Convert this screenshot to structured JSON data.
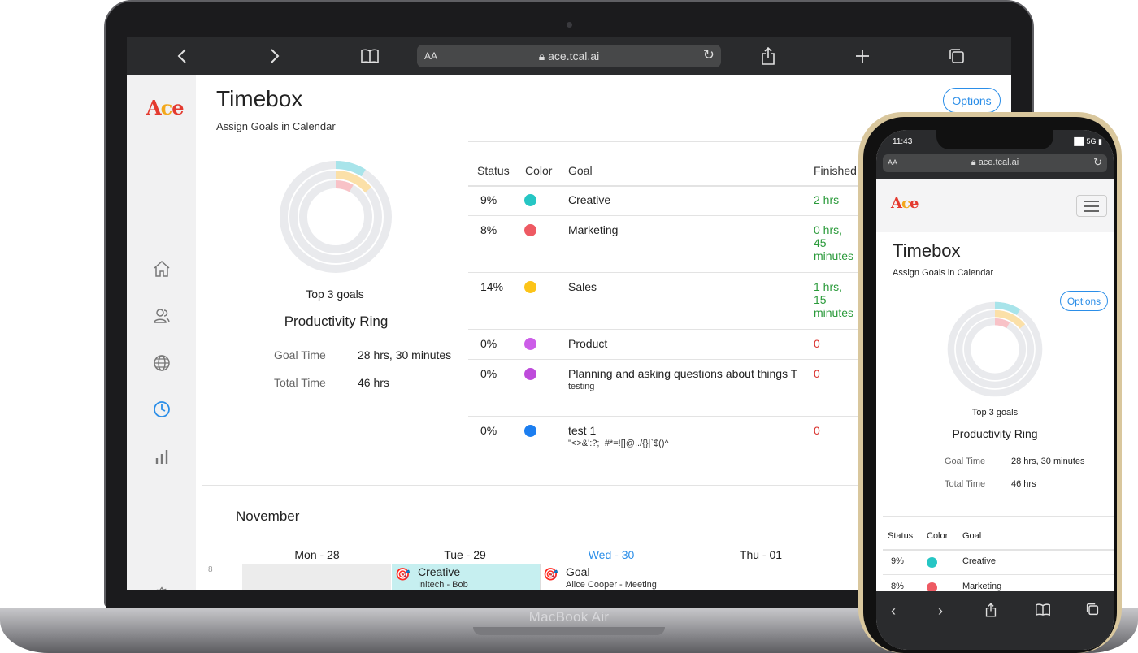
{
  "device_laptop": {
    "brand": "MacBook Air"
  },
  "browser": {
    "url": "ace.tcal.ai",
    "text_size_label": "AA"
  },
  "logo": {
    "letters": [
      "A",
      "c",
      "e"
    ]
  },
  "page": {
    "title": "Timebox",
    "subtitle": "Assign Goals in Calendar",
    "options_label": "Options"
  },
  "ring": {
    "caption": "Top 3 goals",
    "title": "Productivity Ring",
    "goal_time_label": "Goal Time",
    "goal_time_value": "28 hrs, 30 minutes",
    "total_time_label": "Total Time",
    "total_time_value": "46 hrs",
    "segments": [
      {
        "color": "#a8e4ea",
        "fraction": 0.09
      },
      {
        "color": "#fbe0a8",
        "fraction": 0.14
      },
      {
        "color": "#f8c2c7",
        "fraction": 0.08
      }
    ]
  },
  "table": {
    "headers": {
      "status": "Status",
      "color": "Color",
      "goal": "Goal",
      "finished": "Finished"
    },
    "rows": [
      {
        "status": "9%",
        "color": "#26c6c4",
        "goal": "Creative",
        "note": "",
        "finished": "2 hrs",
        "finished_color": "green"
      },
      {
        "status": "8%",
        "color": "#ee5a63",
        "goal": "Marketing",
        "note": "",
        "finished": "0 hrs, 45 minutes",
        "finished_color": "green"
      },
      {
        "status": "14%",
        "color": "#fcc419",
        "goal": "Sales",
        "note": "",
        "finished": "1 hrs, 15 minutes",
        "finished_color": "green"
      },
      {
        "status": "0%",
        "color": "#cc5de8",
        "goal": "Product",
        "note": "",
        "finished": "0",
        "finished_color": "red"
      },
      {
        "status": "0%",
        "color": "#be4bdb",
        "goal": "Planning and asking questions about things Tc",
        "note": "testing",
        "finished": "0",
        "finished_color": "red"
      },
      {
        "status": "0%",
        "color": "#1c7ef0",
        "goal": "test 1",
        "note": "\"<>&':?;+#*=![]@,./{}|`$()^",
        "finished": "0",
        "finished_color": "red"
      }
    ]
  },
  "calendar": {
    "month": "November",
    "hour_label": "8",
    "days": [
      {
        "label": "Mon - 28",
        "highlight": false
      },
      {
        "label": "Tue - 29",
        "highlight": false
      },
      {
        "label": "Wed - 30",
        "highlight": true
      },
      {
        "label": "Thu - 01",
        "highlight": false
      }
    ],
    "events": [
      {
        "title": "Creative",
        "detail": "Initech - Bob"
      },
      {
        "title": "Goal",
        "detail": "Alice Cooper - Meeting"
      }
    ]
  },
  "phone": {
    "time": "11:43",
    "signal": "5G",
    "table_rows": [
      {
        "status": "9%",
        "color": "#26c6c4",
        "goal": "Creative"
      },
      {
        "status": "8%",
        "color": "#ee5a63",
        "goal": "Marketing"
      }
    ]
  }
}
